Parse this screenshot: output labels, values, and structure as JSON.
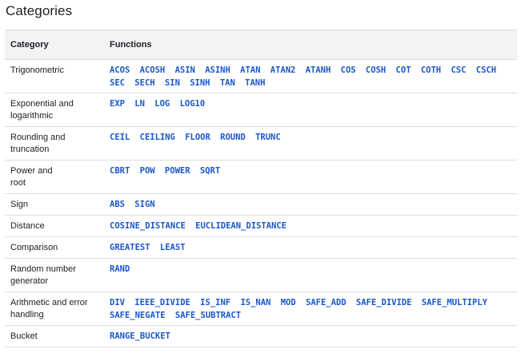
{
  "title": "Categories",
  "headers": {
    "category": "Category",
    "functions": "Functions"
  },
  "link_color": "#1a57c9",
  "rows": [
    {
      "category_lines": [
        "Trigonometric"
      ],
      "functions": [
        "ACOS",
        "ACOSH",
        "ASIN",
        "ASINH",
        "ATAN",
        "ATAN2",
        "ATANH",
        "COS",
        "COSH",
        "COT",
        "COTH",
        "CSC",
        "CSCH",
        "SEC",
        "SECH",
        "SIN",
        "SINH",
        "TAN",
        "TANH"
      ]
    },
    {
      "category_lines": [
        "Exponential and",
        "logarithmic"
      ],
      "functions": [
        "EXP",
        "LN",
        "LOG",
        "LOG10"
      ]
    },
    {
      "category_lines": [
        "Rounding and",
        "truncation"
      ],
      "functions": [
        "CEIL",
        "CEILING",
        "FLOOR",
        "ROUND",
        "TRUNC"
      ]
    },
    {
      "category_lines": [
        "Power and",
        "root"
      ],
      "functions": [
        "CBRT",
        "POW",
        "POWER",
        "SQRT"
      ]
    },
    {
      "category_lines": [
        "Sign"
      ],
      "functions": [
        "ABS",
        "SIGN"
      ]
    },
    {
      "category_lines": [
        "Distance"
      ],
      "functions": [
        "COSINE_DISTANCE",
        "EUCLIDEAN_DISTANCE"
      ]
    },
    {
      "category_lines": [
        "Comparison"
      ],
      "functions": [
        "GREATEST",
        "LEAST"
      ]
    },
    {
      "category_lines": [
        "Random number",
        "generator"
      ],
      "functions": [
        "RAND"
      ]
    },
    {
      "category_lines": [
        "Arithmetic and error",
        "handling"
      ],
      "functions": [
        "DIV",
        "IEEE_DIVIDE",
        "IS_INF",
        "IS_NAN",
        "MOD",
        "SAFE_ADD",
        "SAFE_DIVIDE",
        "SAFE_MULTIPLY",
        "SAFE_NEGATE",
        "SAFE_SUBTRACT"
      ]
    },
    {
      "category_lines": [
        "Bucket"
      ],
      "functions": [
        "RANGE_BUCKET"
      ]
    }
  ]
}
